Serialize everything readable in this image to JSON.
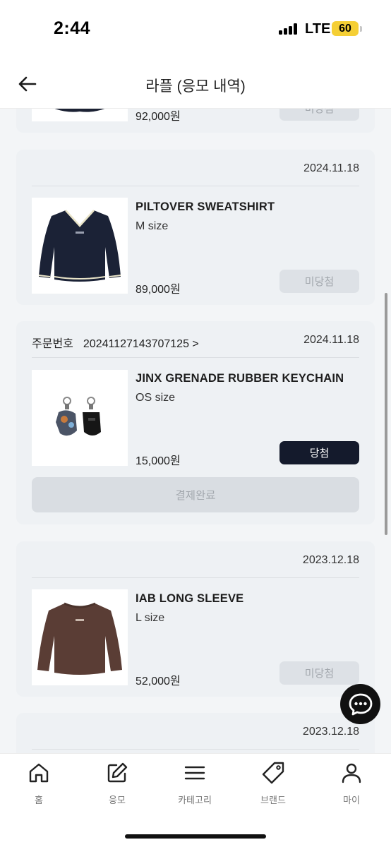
{
  "status_bar": {
    "time": "2:44",
    "network": "LTE",
    "battery": "60"
  },
  "header": {
    "title": "라플 (응모 내역)",
    "back_icon": "arrow-left-icon"
  },
  "cards": [
    {
      "date": "",
      "product_name": "",
      "size": "",
      "price": "92,000원",
      "status": "미당첨"
    },
    {
      "date": "2024.11.18",
      "product_name": "PILTOVER SWEATSHIRT",
      "size": "M size",
      "price": "89,000원",
      "status": "미당첨"
    },
    {
      "order_label": "주문번호",
      "order_number": "20241127143707125 >",
      "date": "2024.11.18",
      "product_name": "JINX GRENADE RUBBER KEYCHAIN",
      "size": "OS size",
      "price": "15,000원",
      "status": "당첨",
      "payment_status": "결제완료"
    },
    {
      "date": "2023.12.18",
      "product_name": "IAB LONG SLEEVE",
      "size": "L size",
      "price": "52,000원",
      "status": "미당첨"
    },
    {
      "date": "2023.12.18"
    }
  ],
  "bottom_nav": [
    {
      "label": "홈",
      "icon": "home-icon"
    },
    {
      "label": "응모",
      "icon": "edit-icon"
    },
    {
      "label": "카테고리",
      "icon": "menu-icon"
    },
    {
      "label": "브랜드",
      "icon": "tag-icon"
    },
    {
      "label": "마이",
      "icon": "user-icon"
    }
  ],
  "chat_fab_icon": "chat-bubble-icon",
  "colors": {
    "win": "#141a2c",
    "card_bg": "#eef1f4",
    "page_bg": "#f3f5f7",
    "lose_bg": "#dde1e6"
  }
}
